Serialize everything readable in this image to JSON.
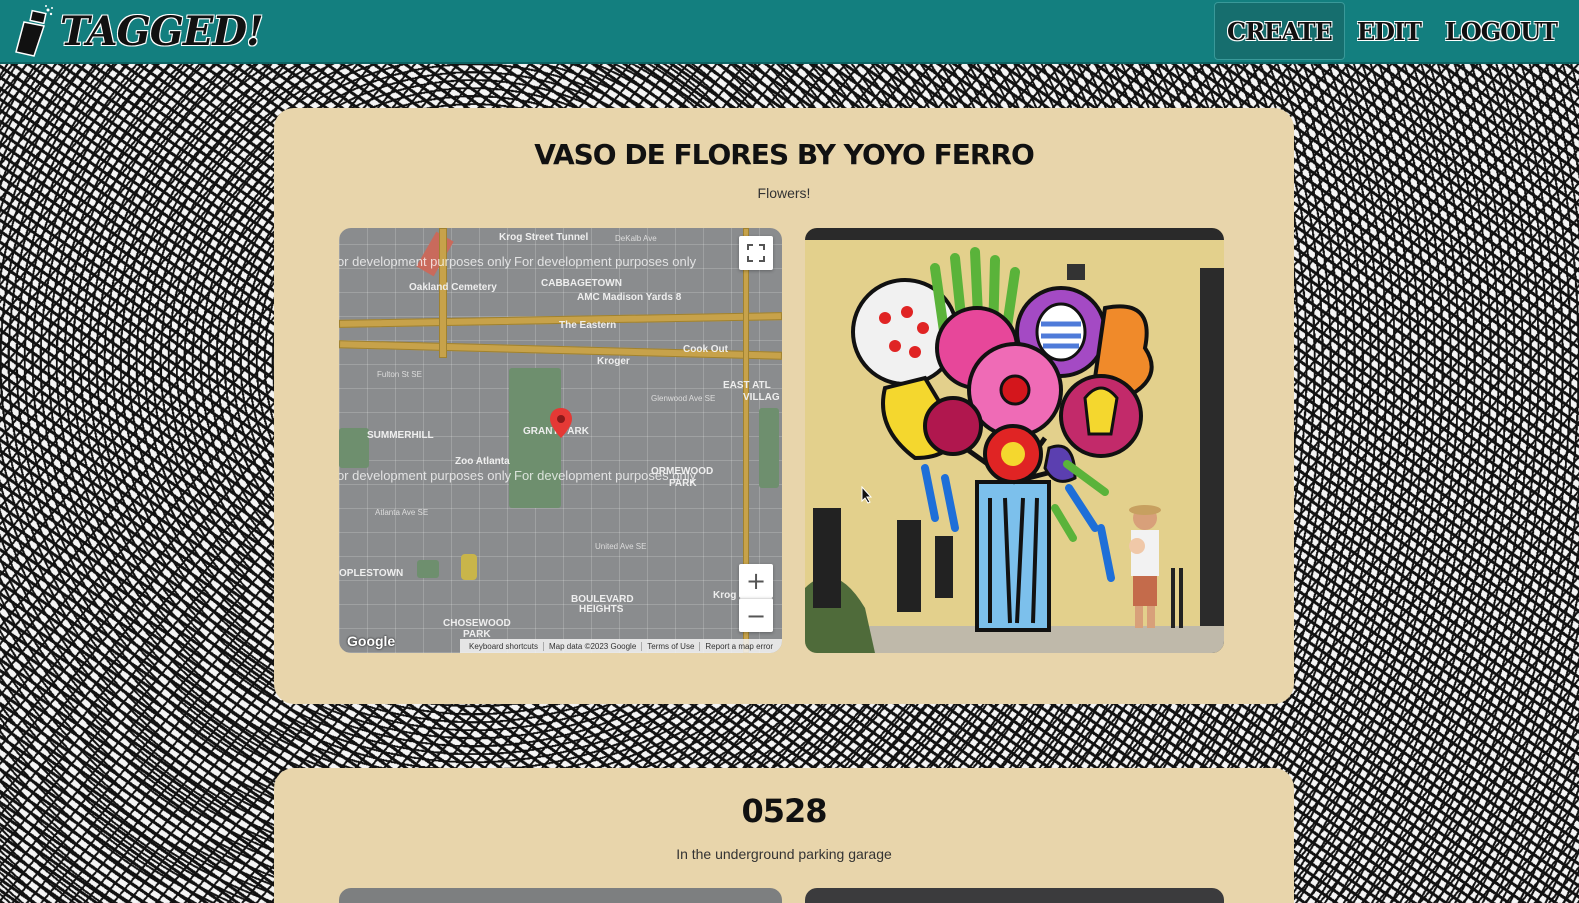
{
  "navbar": {
    "brand": "TAGGED!",
    "links": [
      {
        "label": "CREATE",
        "active": true
      },
      {
        "label": "EDIT",
        "active": false
      },
      {
        "label": "LOGOUT",
        "active": false
      }
    ],
    "background": "#137f7f"
  },
  "posts": [
    {
      "title": "VASO DE FLORES BY YOYO FERRO",
      "description": "Flowers!",
      "map": {
        "watermark": "For development purposes only",
        "labels": {
          "krog": "Krog Street Tunnel",
          "dekalb": "DeKalb Ave",
          "oakland": "Oakland Cemetery",
          "cabbagetown": "CABBAGETOWN",
          "amc": "AMC Madison Yards 8",
          "eastern": "The Eastern",
          "cookout": "Cook Out",
          "kroger": "Kroger",
          "eastatl": "EAST ATL",
          "villag": "VILLAG",
          "fulton": "Fulton St SE",
          "glenwood": "Glenwood Ave SE",
          "summerhill": "SUMMERHILL",
          "grantpark": "GRANT PARK",
          "zoo": "Zoo Atlanta",
          "ormewood": "ORMEWOOD",
          "park": "PARK",
          "atlanta_ave": "Atlanta Ave SE",
          "peoplestown": "OPLESTOWN",
          "boulevard": "BOULEVARD",
          "heights": "HEIGHTS",
          "chosewood": "CHOSEWOOD",
          "chosewood_park": "PARK",
          "united": "United Ave SE",
          "krog2": "Krog"
        },
        "footer": [
          "Keyboard shortcuts",
          "Map data ©2023 Google",
          "Terms of Use",
          "Report a map error"
        ],
        "logo": "Google",
        "zoom_in": "+",
        "zoom_out": "−",
        "fullscreen_icon": "fullscreen-icon"
      },
      "photo": {
        "alt_icon": "mural-photo"
      }
    },
    {
      "title": "0528",
      "description": "In the underground parking garage"
    }
  ]
}
